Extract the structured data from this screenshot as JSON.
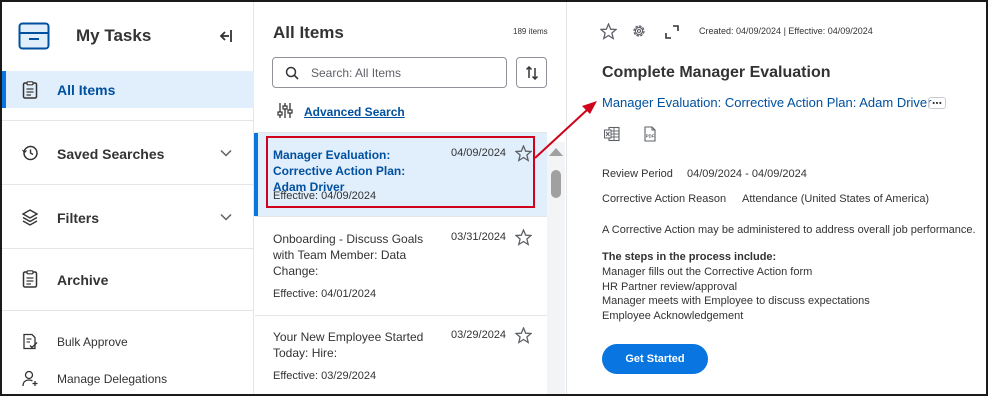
{
  "colors": {
    "accent": "#0875e1",
    "link": "#0050a0",
    "active_bg": "#e1eefb",
    "highlight": "#d0021b"
  },
  "sidebar": {
    "title": "My Tasks",
    "items": [
      {
        "label": "All Items",
        "icon": "clipboard-icon",
        "active": true
      },
      {
        "label": "Saved Searches",
        "icon": "clock-history-icon"
      },
      {
        "label": "Filters",
        "icon": "layers-icon"
      },
      {
        "label": "Archive",
        "icon": "clipboard-icon"
      }
    ],
    "actions": [
      {
        "label": "Bulk Approve",
        "icon": "approve-document-icon"
      },
      {
        "label": "Manage Delegations",
        "icon": "user-plus-icon"
      }
    ]
  },
  "list": {
    "title": "All Items",
    "count": "189 items",
    "search_placeholder": "Search: All Items",
    "advanced_search": "Advanced Search",
    "tasks": [
      {
        "title": "Manager Evaluation: Corrective Action Plan: Adam Driver",
        "date": "04/09/2024",
        "effective": "Effective: 04/09/2024",
        "selected": true
      },
      {
        "title": "Onboarding - Discuss Goals with Team Member: Data Change:",
        "date": "03/31/2024",
        "effective": "Effective: 04/01/2024"
      },
      {
        "title": "Your New Employee Started Today: Hire:",
        "date": "03/29/2024",
        "effective": "Effective: 03/29/2024"
      }
    ]
  },
  "detail": {
    "meta": "Created: 04/09/2024 | Effective: 04/09/2024",
    "title": "Complete Manager Evaluation",
    "link": "Manager Evaluation: Corrective Action Plan: Adam Driver",
    "fields": [
      {
        "label": "Review Period",
        "value": "04/09/2024 - 04/09/2024"
      },
      {
        "label": "Corrective Action Reason",
        "value": "Attendance (United States of America)"
      }
    ],
    "paragraph": "A Corrective Action may be administered to address overall job performance.",
    "steps_heading": "The steps in the process include:",
    "steps": [
      "Manager fills out the Corrective Action form",
      "HR Partner review/approval",
      "Manager meets with Employee to discuss expectations",
      "Employee Acknowledgement"
    ],
    "button": "Get Started"
  }
}
